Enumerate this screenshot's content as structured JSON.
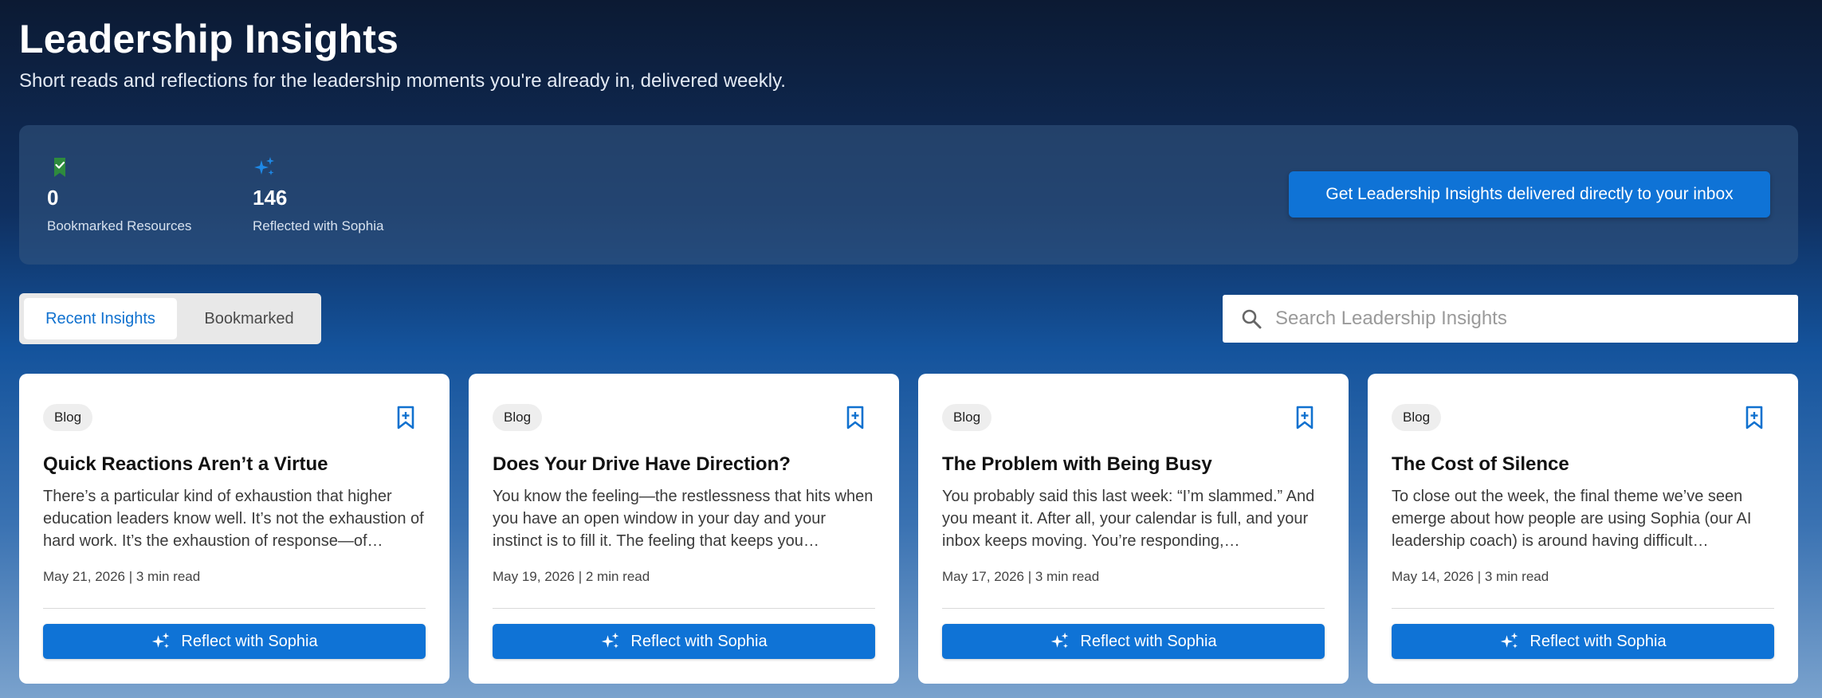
{
  "header": {
    "title": "Leadership Insights",
    "subtitle": "Short reads and reflections for the leadership moments you're already in, delivered weekly."
  },
  "stats": [
    {
      "icon": "bookmark-check-icon",
      "value": "0",
      "label": "Bookmarked Resources"
    },
    {
      "icon": "sparkle-icon",
      "value": "146",
      "label": "Reflected with Sophia"
    }
  ],
  "cta_label": "Get Leadership Insights delivered directly to your inbox",
  "tabs": [
    {
      "label": "Recent Insights",
      "active": true
    },
    {
      "label": "Bookmarked",
      "active": false
    }
  ],
  "search": {
    "placeholder": "Search Leadership Insights",
    "value": ""
  },
  "cards": [
    {
      "tag": "Blog",
      "title": "Quick Reactions Aren’t a Virtue",
      "excerpt": "There’s a particular kind of exhaustion that higher education leaders know well. It’s not the exhaustion of hard work. It’s the exhaustion of response—of…",
      "meta": "May 21, 2026 | 3 min read",
      "button_label": "Reflect with Sophia"
    },
    {
      "tag": "Blog",
      "title": "Does Your Drive Have Direction?",
      "excerpt": "You know the feeling—the restlessness that hits when you have an open window in your day and your instinct is to fill it. The feeling that keeps you…",
      "meta": "May 19, 2026 | 2 min read",
      "button_label": "Reflect with Sophia"
    },
    {
      "tag": "Blog",
      "title": "The Problem with Being Busy",
      "excerpt": "You probably said this last week: “I’m slammed.” And you meant it. After all, your calendar is full, and your inbox keeps moving. You’re responding,…",
      "meta": "May 17, 2026 | 3 min read",
      "button_label": "Reflect with Sophia"
    },
    {
      "tag": "Blog",
      "title": "The Cost of Silence",
      "excerpt": "To close out the week, the final theme we’ve seen emerge about how people are using Sophia (our AI leadership coach) is around having difficult…",
      "meta": "May 14, 2026 | 3 min read",
      "button_label": "Reflect with Sophia"
    }
  ],
  "colors": {
    "accent": "#0f73d6",
    "bookmark_green": "#2e8b3d",
    "sparkle_blue": "#1e88e5"
  }
}
